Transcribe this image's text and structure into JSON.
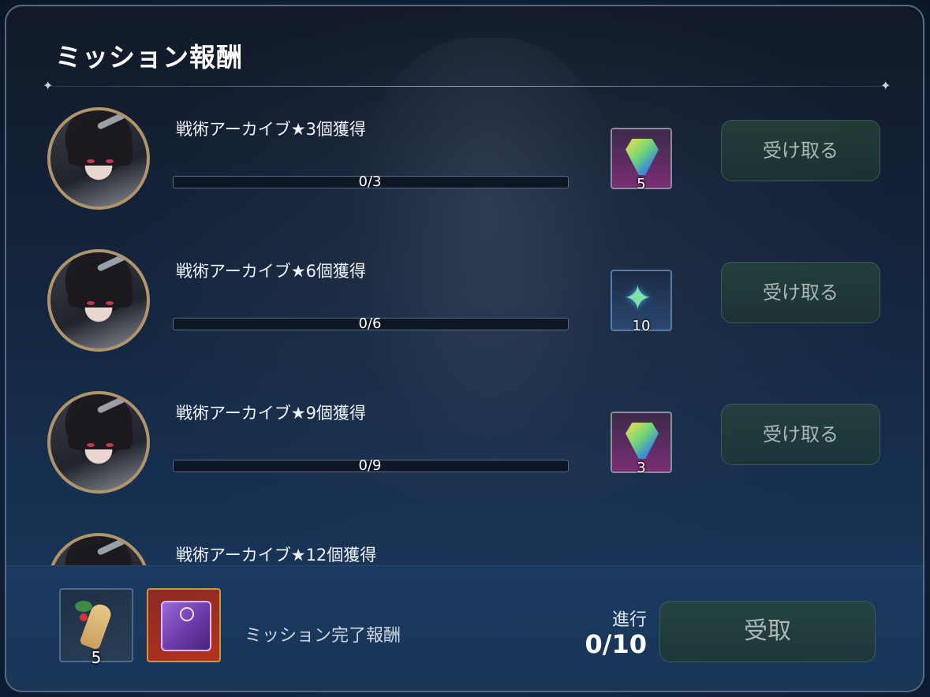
{
  "header": {
    "title": "ミッション報酬"
  },
  "missions": [
    {
      "label": "戦術アーカイブ★3個獲得",
      "progress_text": "0/3",
      "progress_fraction": 0,
      "reward_icon": "hammer-gem-icon",
      "reward_qty": "5",
      "claim_label": "受け取る"
    },
    {
      "label": "戦術アーカイブ★6個獲得",
      "progress_text": "0/6",
      "progress_fraction": 0,
      "reward_icon": "star-compass-icon",
      "reward_qty": "10",
      "claim_label": "受け取る"
    },
    {
      "label": "戦術アーカイブ★9個獲得",
      "progress_text": "0/9",
      "progress_fraction": 0,
      "reward_icon": "exclamation-gem-icon",
      "reward_qty": "3",
      "claim_label": "受け取る"
    },
    {
      "label": "戦術アーカイブ★12個獲得"
    }
  ],
  "footer": {
    "rewards": [
      {
        "icon": "ginseng-icon",
        "qty": "5"
      },
      {
        "icon": "purple-box-icon"
      }
    ],
    "label": "ミッション完了報酬",
    "progress_label": "進行",
    "progress_value": "0/10",
    "claim_label": "受取"
  }
}
